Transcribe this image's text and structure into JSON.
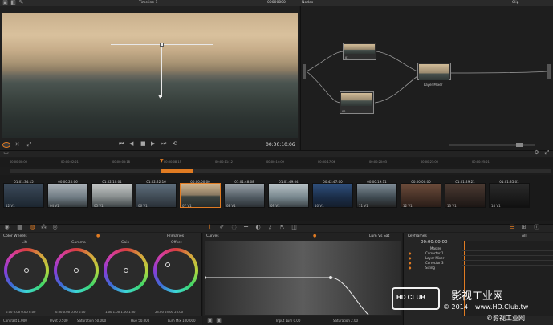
{
  "viewer": {
    "timeline_name": "Timeline 1",
    "source_timecode": "00000000",
    "timecode": "00:00:10:06"
  },
  "nodes_panel": {
    "title": "Nodes",
    "mode": "Clip",
    "layer_mixer_label": "Layer Mixer",
    "node1_label": "01",
    "node2_label": "02",
    "node3_label": "03"
  },
  "timeline": {
    "ruler_ticks": [
      "00:00:00:00",
      "00:00:02:21",
      "00:00:05:18",
      "00:00:08:15",
      "00:00:11:12",
      "00:00:14:09",
      "00:00:17:06",
      "00:00:20:03",
      "00:00:23:00",
      "00:00:25:21"
    ],
    "playhead_position_fraction": 0.29
  },
  "clips": [
    {
      "timecode": "01:01:34:15",
      "label": "12  V1"
    },
    {
      "timecode": "00:00:20:06",
      "label": "04  V1"
    },
    {
      "timecode": "01:02:10:01",
      "label": "05  V1"
    },
    {
      "timecode": "01:02:22:16",
      "label": "06  V1"
    },
    {
      "timecode": "00:00:00:00",
      "label": "07  V1"
    },
    {
      "timecode": "01:01:48:08",
      "label": "08  V1"
    },
    {
      "timecode": "01:01:49:04",
      "label": "09  V1"
    },
    {
      "timecode": "00:42:47:00",
      "label": "10  V1"
    },
    {
      "timecode": "00:00:19:11",
      "label": "11  V1"
    },
    {
      "timecode": "00:00:00:00",
      "label": "12  V1"
    },
    {
      "timecode": "01:01:29:21",
      "label": "13  V1"
    },
    {
      "timecode": "01:01:35:01",
      "label": "14  V1"
    }
  ],
  "color_wheels": {
    "title": "Color Wheels",
    "mode": "Primaries",
    "wheels": [
      {
        "name": "Lift",
        "values": "0.00  0.00  0.00  0.00"
      },
      {
        "name": "Gamma",
        "values": "0.00  0.00  0.00  0.00"
      },
      {
        "name": "Gain",
        "values": "1.00  1.00  1.00  1.00"
      },
      {
        "name": "Offset",
        "values": "25.00  25.00  25.00"
      }
    ],
    "contrast": "Contrast 1.000",
    "pivot": "Pivot 0.500",
    "saturation": "Saturation 50.000",
    "hue": "Hue 50.000",
    "lum_mix": "Lum Mix 100.000"
  },
  "curves": {
    "title": "Curves",
    "mode": "Lum Vs Sat",
    "input_lum": "Input Lum  0.00",
    "saturation": "Saturation  2.00"
  },
  "keyframes": {
    "title": "Keyframes",
    "filter": "All",
    "timecode": "00:00:00:00",
    "tracks": [
      "Master",
      "Corrector 1",
      "Layer Mixer",
      "Corrector 3",
      "Sizing"
    ]
  },
  "watermark": {
    "logo_text": "HD CLUB",
    "cn_text": "影视工业网",
    "copyright": "© 2014",
    "url": "www.HD.Club.tw",
    "cn_line2": "©影视工业网"
  },
  "colors": {
    "accent": "#e07b22",
    "panel_bg": "#262626",
    "window_bg": "#1c1c1c"
  }
}
